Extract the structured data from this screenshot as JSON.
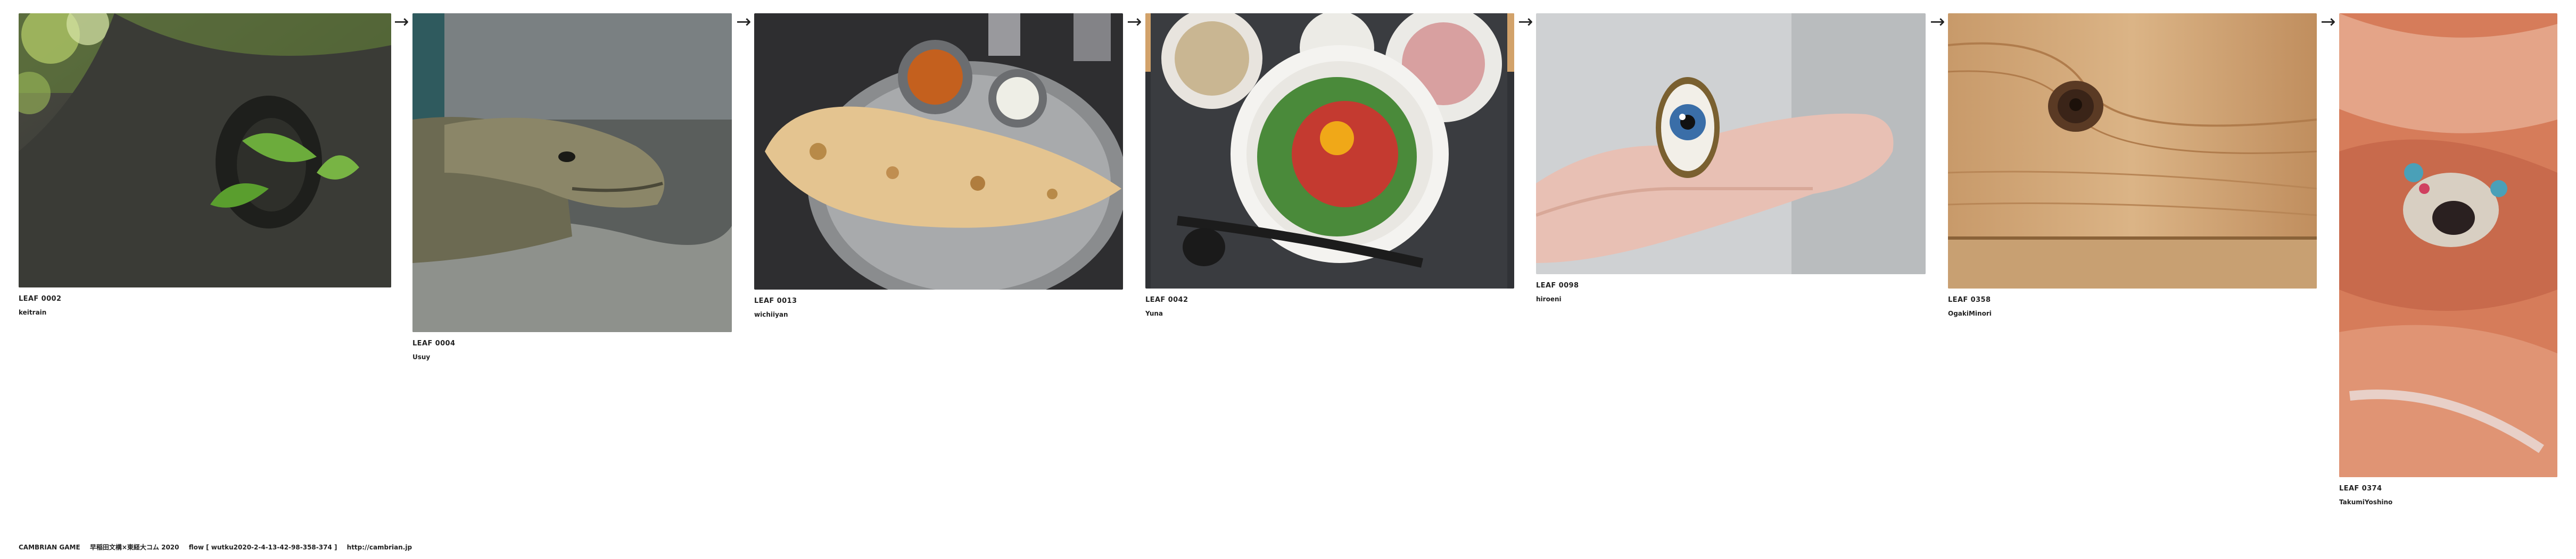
{
  "leaves": [
    {
      "id": "LEAF 0002",
      "author": "keitrain",
      "image": "tree-knot-photo"
    },
    {
      "id": "LEAF 0004",
      "author": "Usuy",
      "image": "lizard-photo"
    },
    {
      "id": "LEAF 0013",
      "author": "wichiiyan",
      "image": "naan-curry-photo"
    },
    {
      "id": "LEAF 0042",
      "author": "Yuna",
      "image": "yukhoe-bowl-photo"
    },
    {
      "id": "LEAF 0098",
      "author": "hiroeni",
      "image": "eye-ring-photo"
    },
    {
      "id": "LEAF 0358",
      "author": "OgakiMinori",
      "image": "wood-knot-photo"
    },
    {
      "id": "LEAF 0374",
      "author": "TakumiYoshino",
      "image": "dog-blanket-photo"
    }
  ],
  "arrow_glyph": "→",
  "footer": {
    "title": "CAMBRIAN GAME",
    "credit": "早稲田文構×東経大コム 2020",
    "flow": "flow [ wutku2020-2-4-13-42-98-358-374 ]",
    "link": "http://cambrian.jp"
  }
}
